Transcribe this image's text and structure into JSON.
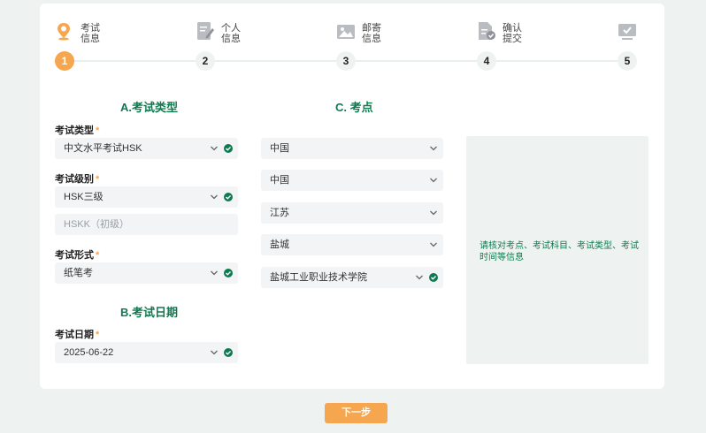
{
  "steps": [
    {
      "number": "1",
      "label_line1": "考试",
      "label_line2": "信息",
      "icon": "map-pin-icon",
      "active": true
    },
    {
      "number": "2",
      "label_line1": "个人",
      "label_line2": "信息",
      "icon": "edit-document-icon",
      "active": false
    },
    {
      "number": "3",
      "label_line1": "邮寄",
      "label_line2": "信息",
      "icon": "image-icon",
      "active": false
    },
    {
      "number": "4",
      "label_line1": "确认",
      "label_line2": "提交",
      "icon": "document-check-icon",
      "active": false
    },
    {
      "number": "5",
      "label_line1": "",
      "label_line2": "",
      "icon": "monitor-check-icon",
      "active": false
    }
  ],
  "colors": {
    "accent": "#f5a64e",
    "brand_green": "#0e7a50",
    "field_bg": "#f2f4f6",
    "page_bg": "#eef3f1"
  },
  "section_a": {
    "title": "A.考试类型",
    "exam_type": {
      "label": "考试类型",
      "required_mark": "*",
      "value": "中文水平考试HSK",
      "valid": true
    },
    "exam_level": {
      "label": "考试级别",
      "required_mark": "*",
      "value": "HSK三级",
      "valid": true
    },
    "exam_level_alt": {
      "placeholder": "HSKK（初级）"
    },
    "exam_form": {
      "label": "考试形式",
      "required_mark": "*",
      "value": "纸笔考",
      "valid": true
    }
  },
  "section_b": {
    "title": "B.考试日期",
    "exam_date": {
      "label": "考试日期",
      "required_mark": "*",
      "value": "2025-06-22",
      "valid": true
    }
  },
  "section_c": {
    "title": "C. 考点",
    "country": "中国",
    "region": "中国",
    "province": "江苏",
    "city": "盐城",
    "site": "盐城工业职业技术学院",
    "hint": "请核对考点、考试科目、考试类型、考试时间等信息"
  },
  "next_button": "下一步"
}
